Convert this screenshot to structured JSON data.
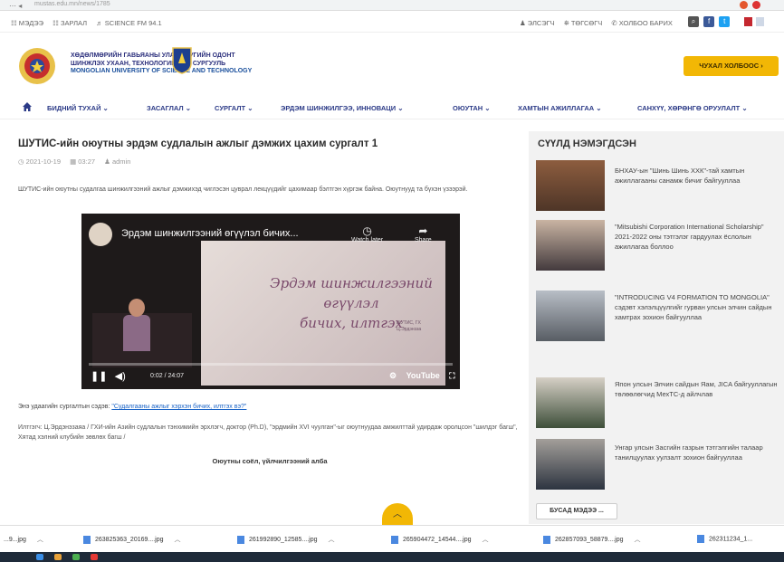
{
  "browser": {
    "url": "mustas.edu.mn/news/1785"
  },
  "topbar": {
    "left": [
      "☷ МЭДЭЭ",
      "☷ ЗАРЛАЛ",
      "♬ SCIENCE FM 94.1"
    ],
    "right": [
      "♟ ЭЛСЭГЧ",
      "⛯ ТӨГСӨГЧ",
      "✆ ХОЛБОО БАРИХ"
    ]
  },
  "header": {
    "org_mn_line1": "ХӨДӨЛМӨРИЙН ГАВЬЯАНЫ УЛААН ТУГИЙН ОДОНТ",
    "org_mn_line2": "ШИНЖЛЭХ УХААН, ТЕХНОЛОГИЙН ИХ СУРГУУЛЬ",
    "org_en": "MONGOLIAN UNIVERSITY OF SCIENCE AND TECHNOLOGY",
    "cta": "ЧУХАЛ ХОЛБООС ›"
  },
  "nav": [
    "БИДНИЙ ТУХАЙ ⌄",
    "ЗАСАГЛАЛ ⌄",
    "СУРГАЛТ ⌄",
    "ЭРДЭМ ШИНЖИЛГЭЭ, ИННОВАЦИ ⌄",
    "ОЮУТАН ⌄",
    "ХАМТЫН АЖИЛЛАГАА ⌄",
    "САНХҮҮ, ХӨРӨНГӨ ОРУУЛАЛТ ⌄"
  ],
  "article": {
    "title": "ШУТИС-ийн оюутны эрдэм судлалын ажлыг дэмжих цахим сургалт 1",
    "date": "◷ 2021-10-19",
    "time": "▦ 03:27",
    "author": "♟ admin",
    "intro": "ШУТИС-ийн оюутны судалгаа шинжилгээний ажлыг дэмжихэд чиглэсэн цуврал лекцүүдийг цахимаар бэлтгэн хүргэж байна. Оюутнууд та бүхэн үзээрэй.",
    "source_label": "Энэ удаагийн сургалтын сэдэв:",
    "source_link": "\"Судалгааны ажлыг хэрхэн бичих, илтгэх вэ?\"",
    "credits": "Илтгэгч: Ц.Эрдэнэзаяа   / ГХИ-ийн Азийн судлалын тэнхимийн эрхлэгч, доктор (Ph.D), \"эрдмийн XVI чуулган\"-ыг оюутнуудаа амжилттай удирдаж оролцсон \"шилдэг багш\", Хятад хэлний клубийн зөвлөх багш /",
    "album": "Оюутны соёл, үйлчилгээний алба"
  },
  "video": {
    "title": "Эрдэм шинжилгээний өгүүлэл бичих...",
    "watch_later": "Watch later",
    "share": "Share",
    "screen_line1": "Эрдэм шинжилгээний өгүүлэл",
    "screen_line2": "бичих, илтгэх",
    "screen_small": "ШУТИС, ГХ\nЦ.Эрдэнэза",
    "time": "0:02 / 24:07",
    "youtube": "YouTube"
  },
  "sidebar": {
    "title": "СҮҮЛД НЭМЭГДСЭН",
    "items": [
      {
        "text": "БНХАУ-ын \"Шинь Шинь ХХК\"-тай хамтын ажиллагааны санамж бичиг байгууллаа"
      },
      {
        "text": "\"Mitsubishi Corporation International Scholarship\" 2021-2022 оны тэтгэлэг гардуулах ёслолын ажиллагаа боллоо"
      },
      {
        "text": "\"INTRODUCING V4 FORMATION TO MONGOLIA\" сэдэвт хэлэлцүүлгийг гурван улсын элчин сайдын хамтрах зохион байгууллаа"
      },
      {
        "text": "Япон улсын Элчин сайдын Яам, JICA байгууллагын төлөөлөгчид МехТС-д айлчлав"
      },
      {
        "text": "Унгар улсын Засгийн газрын тэтгэлгийн талаар танилцуулах уулзалт зохион байгууллаа"
      }
    ],
    "more": "БУСАД МЭДЭЭ ..."
  },
  "downloads": [
    "...9...jpg",
    "263825363_20169....jpg",
    "261992890_12585....jpg",
    "265904472_14544....jpg",
    "262857093_58879....jpg",
    "262311234_1..."
  ]
}
